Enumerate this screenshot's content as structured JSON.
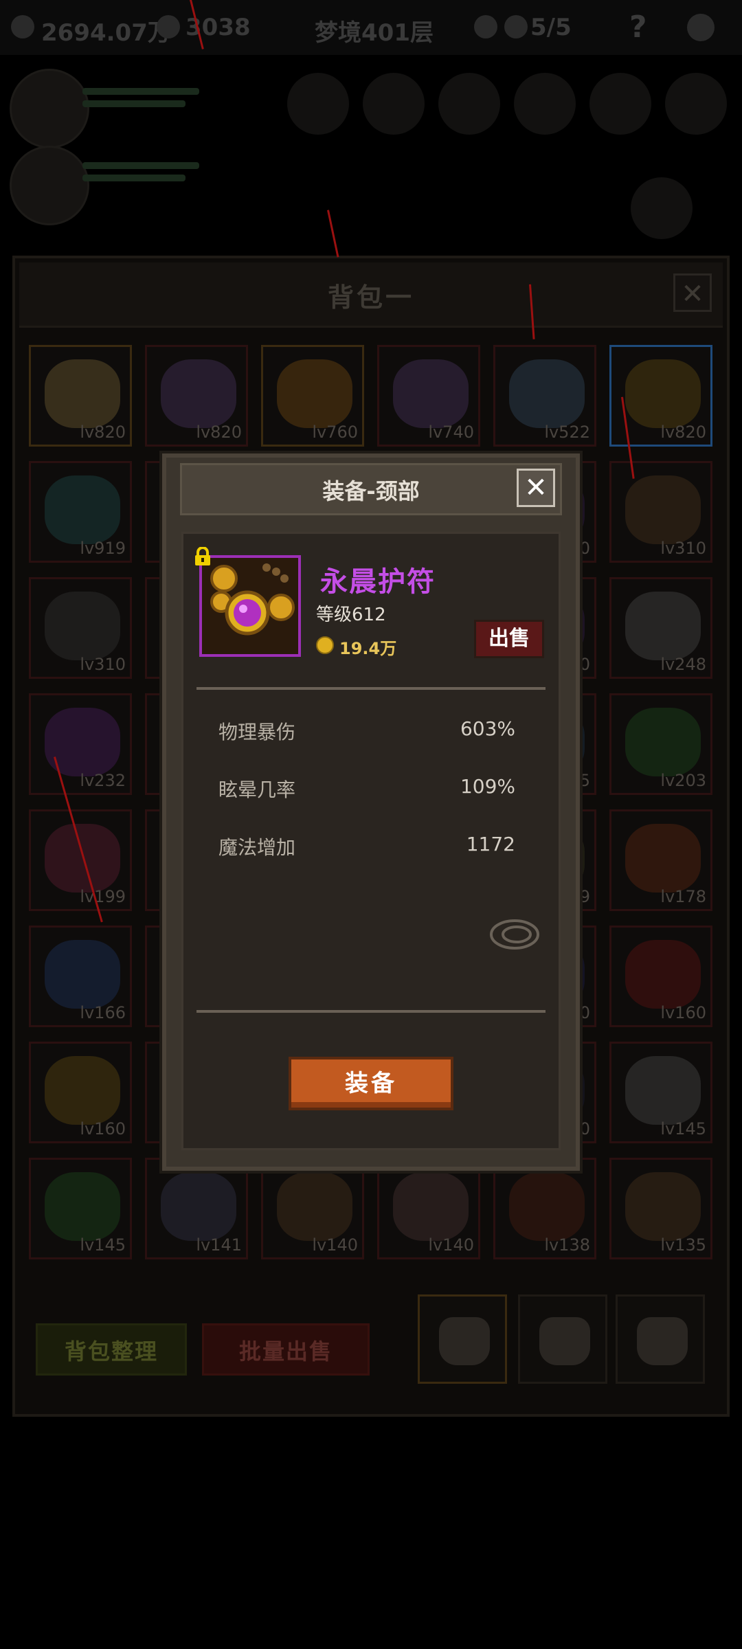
{
  "topbar": {
    "gold": "2694.07万",
    "gems": "3038",
    "dungeon": "梦境401层",
    "skulls": "5/5",
    "help": "?"
  },
  "bag": {
    "title": "背包一",
    "close": "✕",
    "items": [
      {
        "level": "lv820",
        "icon": "ring-icon",
        "color": "#5a4a2a"
      },
      {
        "level": "lv820",
        "icon": "armor-icon",
        "color": "#3a2a4a"
      },
      {
        "level": "lv760",
        "icon": "cloak-icon",
        "color": "#5a3a10"
      },
      {
        "level": "lv740",
        "icon": "armor-icon",
        "color": "#3a2a4a"
      },
      {
        "level": "lv522",
        "icon": "dagger-icon",
        "color": "#2a3a4a"
      },
      {
        "level": "lv820",
        "icon": "amulet-icon",
        "color": "#4a3a10"
      },
      {
        "level": "lv919",
        "icon": "claw-icon",
        "color": "#1a3a3a"
      },
      {
        "level": "",
        "icon": "empty-icon",
        "color": "#1a1a1a"
      },
      {
        "level": "",
        "icon": "empty-icon",
        "color": "#1a1a1a"
      },
      {
        "level": "",
        "icon": "empty-icon",
        "color": "#1a1a1a"
      },
      {
        "level": "0",
        "icon": "gem-icon",
        "color": "#2a1a3a"
      },
      {
        "level": "lv310",
        "icon": "skull-shield-icon",
        "color": "#3a2a1a"
      },
      {
        "level": "lv310",
        "icon": "whip-icon",
        "color": "#2a2a2a"
      },
      {
        "level": "",
        "icon": "empty-icon",
        "color": "#1a1a1a"
      },
      {
        "level": "",
        "icon": "empty-icon",
        "color": "#1a1a1a"
      },
      {
        "level": "",
        "icon": "empty-icon",
        "color": "#1a1a1a"
      },
      {
        "level": "0",
        "icon": "gem-icon",
        "color": "#2a1a3a"
      },
      {
        "level": "lv248",
        "icon": "hammer-icon",
        "color": "#3a3a3a"
      },
      {
        "level": "lv232",
        "icon": "crystal-icon",
        "color": "#3a1a4a"
      },
      {
        "level": "",
        "icon": "empty-icon",
        "color": "#1a1a1a"
      },
      {
        "level": "",
        "icon": "empty-icon",
        "color": "#1a1a1a"
      },
      {
        "level": "",
        "icon": "empty-icon",
        "color": "#1a1a1a"
      },
      {
        "level": "5",
        "icon": "gem-icon",
        "color": "#1a2a3a"
      },
      {
        "level": "lv203",
        "icon": "cloak-icon",
        "color": "#1a3a1a"
      },
      {
        "level": "lv199",
        "icon": "armor-icon",
        "color": "#4a1a2a"
      },
      {
        "level": "",
        "icon": "empty-icon",
        "color": "#1a1a1a"
      },
      {
        "level": "",
        "icon": "empty-icon",
        "color": "#1a1a1a"
      },
      {
        "level": "",
        "icon": "empty-icon",
        "color": "#1a1a1a"
      },
      {
        "level": "9",
        "icon": "gem-icon",
        "color": "#2a2a1a"
      },
      {
        "level": "lv178",
        "icon": "dagger-icon",
        "color": "#4a2010"
      },
      {
        "level": "lv166",
        "icon": "sword-icon",
        "color": "#1a2a4a"
      },
      {
        "level": "",
        "icon": "empty-icon",
        "color": "#1a1a1a"
      },
      {
        "level": "",
        "icon": "empty-icon",
        "color": "#1a1a1a"
      },
      {
        "level": "",
        "icon": "empty-icon",
        "color": "#1a1a1a"
      },
      {
        "level": "0",
        "icon": "gem-icon",
        "color": "#1a1a3a"
      },
      {
        "level": "lv160",
        "icon": "necklace-icon",
        "color": "#4a1010"
      },
      {
        "level": "lv160",
        "icon": "ring-icon",
        "color": "#4a3a10"
      },
      {
        "level": "",
        "icon": "empty-icon",
        "color": "#1a1a1a"
      },
      {
        "level": "",
        "icon": "empty-icon",
        "color": "#1a1a1a"
      },
      {
        "level": "",
        "icon": "empty-icon",
        "color": "#1a1a1a"
      },
      {
        "level": "0",
        "icon": "gem-icon",
        "color": "#1a1a2a"
      },
      {
        "level": "lv145",
        "icon": "blade-icon",
        "color": "#3a3a3a"
      },
      {
        "level": "lv145",
        "icon": "orb-icon",
        "color": "#1a3a1a"
      },
      {
        "level": "lv141",
        "icon": "gun-icon",
        "color": "#2a2a3a"
      },
      {
        "level": "lv140",
        "icon": "bow-icon",
        "color": "#3a2a1a"
      },
      {
        "level": "lv140",
        "icon": "helmet-icon",
        "color": "#3a2a2a"
      },
      {
        "level": "lv138",
        "icon": "trident-icon",
        "color": "#3a1a10"
      },
      {
        "level": "lv135",
        "icon": "bow-icon",
        "color": "#3a2a1a"
      }
    ],
    "sort_button": "背包整理",
    "bulk_sell_button": "批量出售",
    "tabs": [
      "bag-tab-1",
      "bag-tab-2",
      "bag-tab-3"
    ]
  },
  "modal": {
    "title": "装备-颈部",
    "close": "✕",
    "item": {
      "name": "永晨护符",
      "level_text": "等级612",
      "price": "19.4万",
      "locked": true,
      "icon": "amulet-icon",
      "rarity_color": "#9c2fb6"
    },
    "sell_button": "出售",
    "stats": [
      {
        "label": "物理暴伤",
        "value": "603%"
      },
      {
        "label": "眩晕几率",
        "value": "109%"
      },
      {
        "label": "魔法增加",
        "value": "1172"
      }
    ],
    "equip_button": "装备"
  },
  "colors": {
    "name_purple": "#c44ee6",
    "price_gold": "#e8c55a",
    "equip_orange": "#c25a20",
    "sell_red": "#5a1818"
  }
}
